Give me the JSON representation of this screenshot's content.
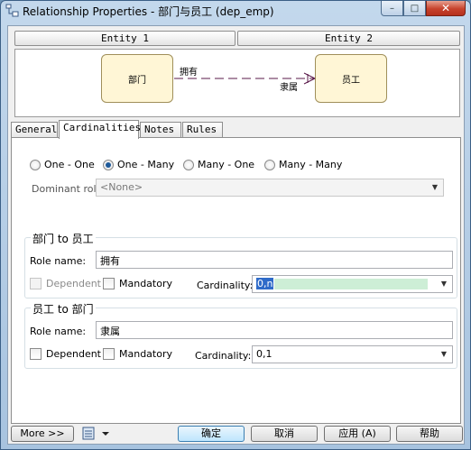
{
  "window": {
    "title": "Relationship Properties - 部门与员工 (dep_emp)",
    "icon": "relationship-icon",
    "controls": {
      "minimize": "–",
      "maximize": "□",
      "close": "✕"
    }
  },
  "header": {
    "entity1_label": "Entity 1",
    "entity2_label": "Entity 2"
  },
  "diagram": {
    "entity1": "部门",
    "entity2": "员工",
    "role1": "拥有",
    "role2": "隶属",
    "line_color": "#5a1a4a",
    "entity_fill": "#fff6d6"
  },
  "tabs": [
    {
      "label": "General"
    },
    {
      "label": "Cardinalities",
      "active": true
    },
    {
      "label": "Notes"
    },
    {
      "label": "Rules"
    }
  ],
  "cardinality_options": [
    {
      "label": "One - One",
      "selected": false
    },
    {
      "label": "One - Many",
      "selected": true
    },
    {
      "label": "Many - One",
      "selected": false
    },
    {
      "label": "Many - Many",
      "selected": false
    }
  ],
  "dominant_role": {
    "label": "Dominant role:",
    "value": "<None>"
  },
  "group1": {
    "title": "部门 to 员工",
    "role_name_label": "Role name:",
    "role_name_value": "拥有",
    "dependent_label": "Dependent",
    "mandatory_label": "Mandatory",
    "cardinality_label": "Cardinality:",
    "cardinality_value": "0,n"
  },
  "group2": {
    "title": "员工 to 部门",
    "role_name_label": "Role name:",
    "role_name_value": "隶属",
    "dependent_label": "Dependent",
    "mandatory_label": "Mandatory",
    "cardinality_label": "Cardinality:",
    "cardinality_value": "0,1"
  },
  "footer": {
    "more_label": "More >>",
    "ok_label": "确定",
    "cancel_label": "取消",
    "apply_label": "应用 (A)",
    "help_label": "帮助"
  }
}
